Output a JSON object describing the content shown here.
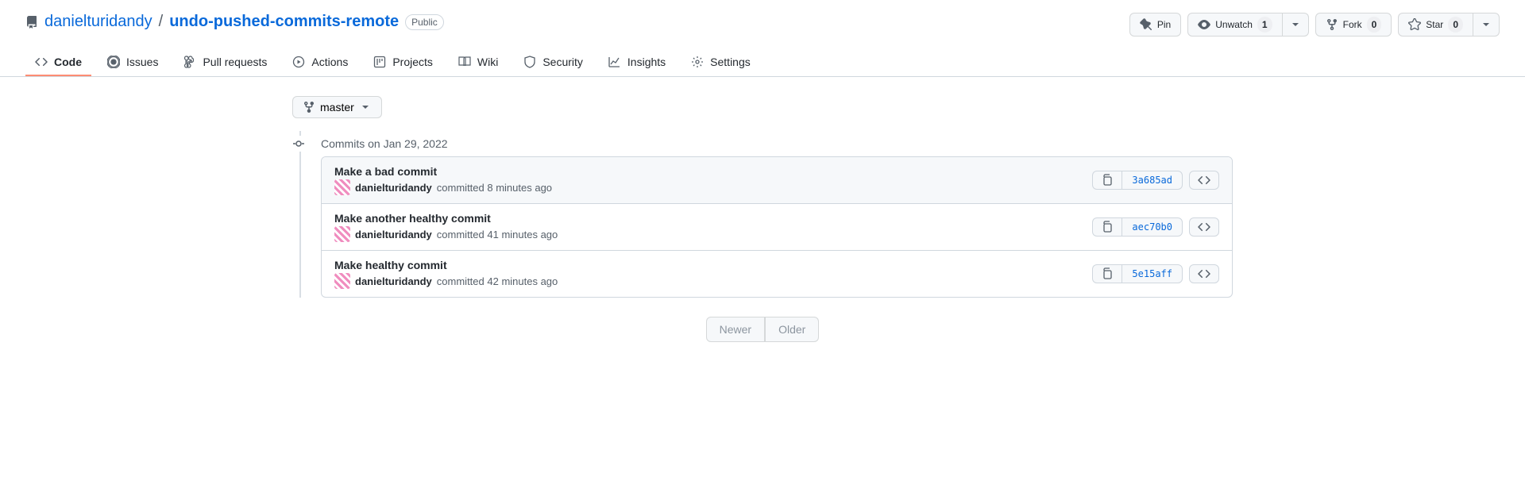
{
  "repo": {
    "owner": "danielturidandy",
    "name": "undo-pushed-commits-remote",
    "visibility": "Public"
  },
  "actions": {
    "pin": "Pin",
    "unwatch": "Unwatch",
    "unwatch_count": "1",
    "fork": "Fork",
    "fork_count": "0",
    "star": "Star",
    "star_count": "0"
  },
  "tabs": [
    {
      "label": "Code"
    },
    {
      "label": "Issues"
    },
    {
      "label": "Pull requests"
    },
    {
      "label": "Actions"
    },
    {
      "label": "Projects"
    },
    {
      "label": "Wiki"
    },
    {
      "label": "Security"
    },
    {
      "label": "Insights"
    },
    {
      "label": "Settings"
    }
  ],
  "branch": "master",
  "date_group": "Commits on Jan 29, 2022",
  "commits": [
    {
      "title": "Make a bad commit",
      "author": "danielturidandy",
      "time": "committed 8 minutes ago",
      "sha": "3a685ad"
    },
    {
      "title": "Make another healthy commit",
      "author": "danielturidandy",
      "time": "committed 41 minutes ago",
      "sha": "aec70b0"
    },
    {
      "title": "Make healthy commit",
      "author": "danielturidandy",
      "time": "committed 42 minutes ago",
      "sha": "5e15aff"
    }
  ],
  "pagination": {
    "newer": "Newer",
    "older": "Older"
  }
}
